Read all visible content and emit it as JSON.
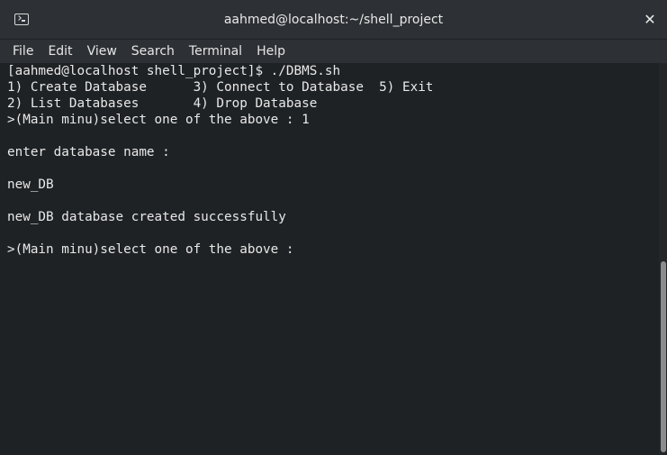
{
  "window": {
    "title": "aahmed@localhost:~/shell_project",
    "close_label": "✕",
    "icon": "terminal-icon"
  },
  "menu": {
    "items": [
      "File",
      "Edit",
      "View",
      "Search",
      "Terminal",
      "Help"
    ]
  },
  "terminal": {
    "lines": [
      "[aahmed@localhost shell_project]$ ./DBMS.sh",
      "1) Create Database      3) Connect to Database  5) Exit",
      "2) List Databases       4) Drop Database",
      ">(Main minu)select one of the above : 1",
      "",
      "enter database name :",
      "",
      "new_DB",
      "",
      "new_DB database created successfully",
      "",
      ">(Main minu)select one of the above :"
    ]
  },
  "colors": {
    "background": "#1f2225",
    "titlebar": "#2d3034",
    "text": "#e8e8e8",
    "scroll_thumb": "#8a8d90"
  }
}
